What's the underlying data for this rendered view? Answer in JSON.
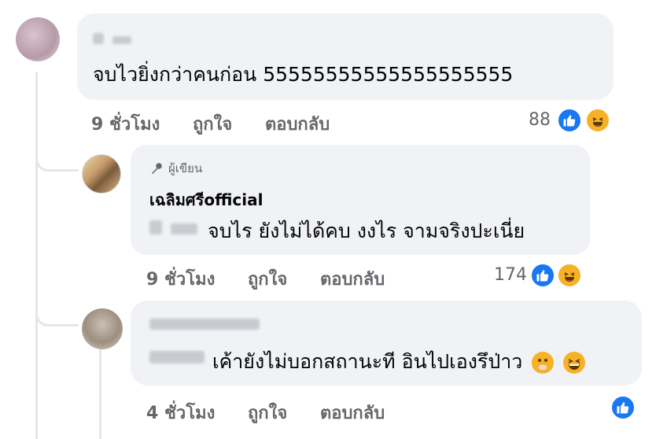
{
  "comments": [
    {
      "text": "จบไวยิ่งกว่าคนก่อน 55555555555555555555",
      "time": "9 ชั่วโมง",
      "like_label": "ถูกใจ",
      "reply_label": "ตอบกลับ",
      "reaction_count": "88"
    },
    {
      "author_badge": "ผู้เขียน",
      "name": "เฉลิมศรีofficial",
      "text": "จบไร ยังไม่ได้คบ งงไร จามจริงปะเนี่ย",
      "time": "9 ชั่วโมง",
      "like_label": "ถูกใจ",
      "reply_label": "ตอบกลับ",
      "reaction_count": "174"
    },
    {
      "text": "เค้ายังไม่บอกสถานะที อินไปเองรึป่าว",
      "time": "4 ชั่วโมง",
      "like_label": "ถูกใจ",
      "reply_label": "ตอบกลับ"
    }
  ],
  "colors": {
    "bubble": "#f0f2f5",
    "meta": "#65676b",
    "like_blue": "#1877f2",
    "haha_yellow": "#f7b125"
  }
}
